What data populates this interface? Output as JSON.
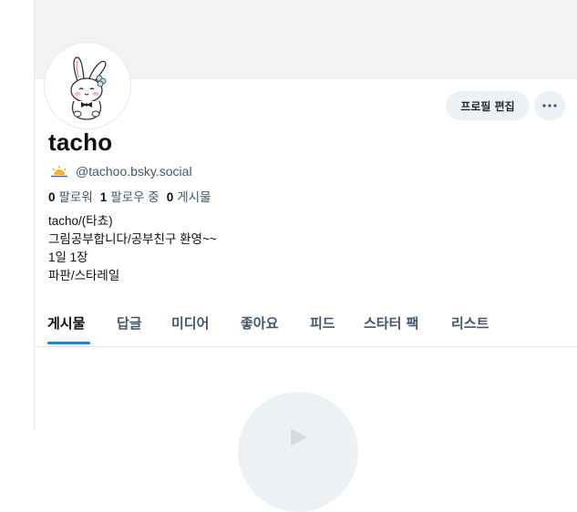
{
  "profile": {
    "display_name": "tacho",
    "handle": "@tachoo.bsky.social",
    "stats": {
      "followers_count": "0",
      "followers_label": "팔로워",
      "following_count": "1",
      "following_label": "팔로우 중",
      "posts_count": "0",
      "posts_label": "게시물"
    },
    "bio_lines": [
      "tacho/(타쵸)",
      "그림공부합니다/공부친구 환영~~",
      "1일 1장",
      "파판/스타레일"
    ]
  },
  "actions": {
    "edit_profile_label": "프로필 편집",
    "more_icon": "ellipsis-icon"
  },
  "tabs": [
    {
      "label": "게시물",
      "active": true
    },
    {
      "label": "답글",
      "active": false
    },
    {
      "label": "미디어",
      "active": false
    },
    {
      "label": "좋아요",
      "active": false
    },
    {
      "label": "피드",
      "active": false
    },
    {
      "label": "스타터 팩",
      "active": false
    },
    {
      "label": "리스트",
      "active": false
    }
  ],
  "colors": {
    "accent": "#1083fe",
    "muted_text": "#42576c",
    "banner": "#f1f3f5"
  }
}
